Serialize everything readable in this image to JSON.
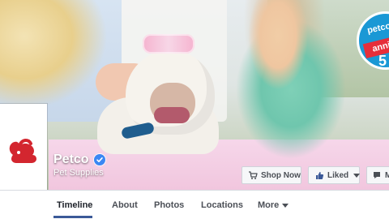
{
  "cover": {
    "badge": {
      "small_text": "petco",
      "ribbon_text": "anni",
      "big_text": "5"
    }
  },
  "page": {
    "name": "Petco",
    "category": "Pet Supplies"
  },
  "actions": {
    "shop_now": "Shop Now",
    "liked": "Liked",
    "message": "M"
  },
  "tabs": [
    {
      "label": "Timeline"
    },
    {
      "label": "About"
    },
    {
      "label": "Photos"
    },
    {
      "label": "Locations"
    },
    {
      "label": "More"
    }
  ],
  "colors": {
    "facebook_blue": "#3b5998",
    "verified_blue": "#3b87f3",
    "petco_red": "#d3262f",
    "badge_blue": "#1a98d5"
  }
}
